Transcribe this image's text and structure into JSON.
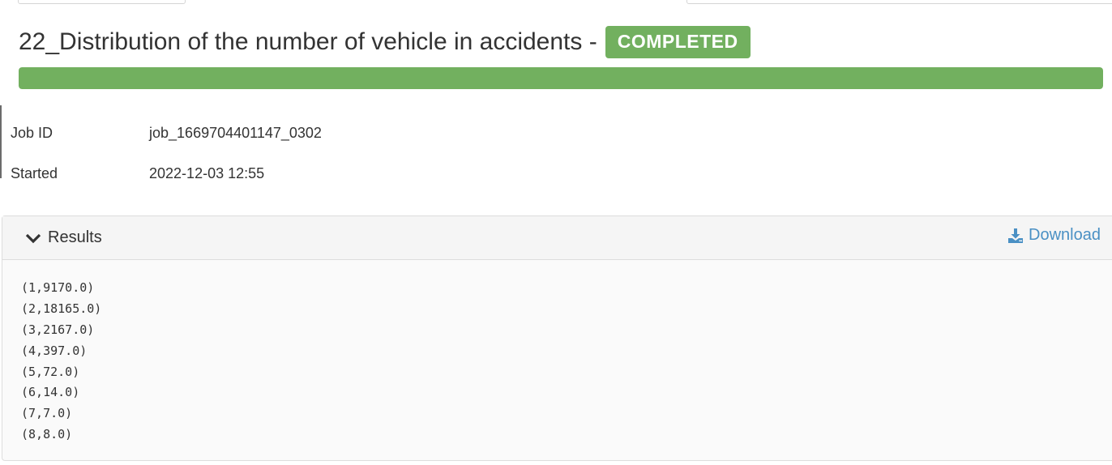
{
  "job": {
    "title": "22_Distribution of the number of vehicle in accidents -",
    "status": "COMPLETED",
    "progress_percent": 100,
    "status_color": "#72b05f"
  },
  "details": {
    "job_id_label": "Job ID",
    "job_id_value": "job_1669704401147_0302",
    "started_label": "Started",
    "started_value": "2022-12-03 12:55"
  },
  "results_panel": {
    "toggle_label": "Results",
    "toggle_icon": "chevron-down-icon",
    "download_label": "Download",
    "download_icon": "download-icon",
    "accent_color": "#4a90c4",
    "lines": [
      "(1,9170.0)",
      "(2,18165.0)",
      "(3,2167.0)",
      "(4,397.0)",
      "(5,72.0)",
      "(6,14.0)",
      "(7,7.0)",
      "(8,8.0)"
    ]
  }
}
